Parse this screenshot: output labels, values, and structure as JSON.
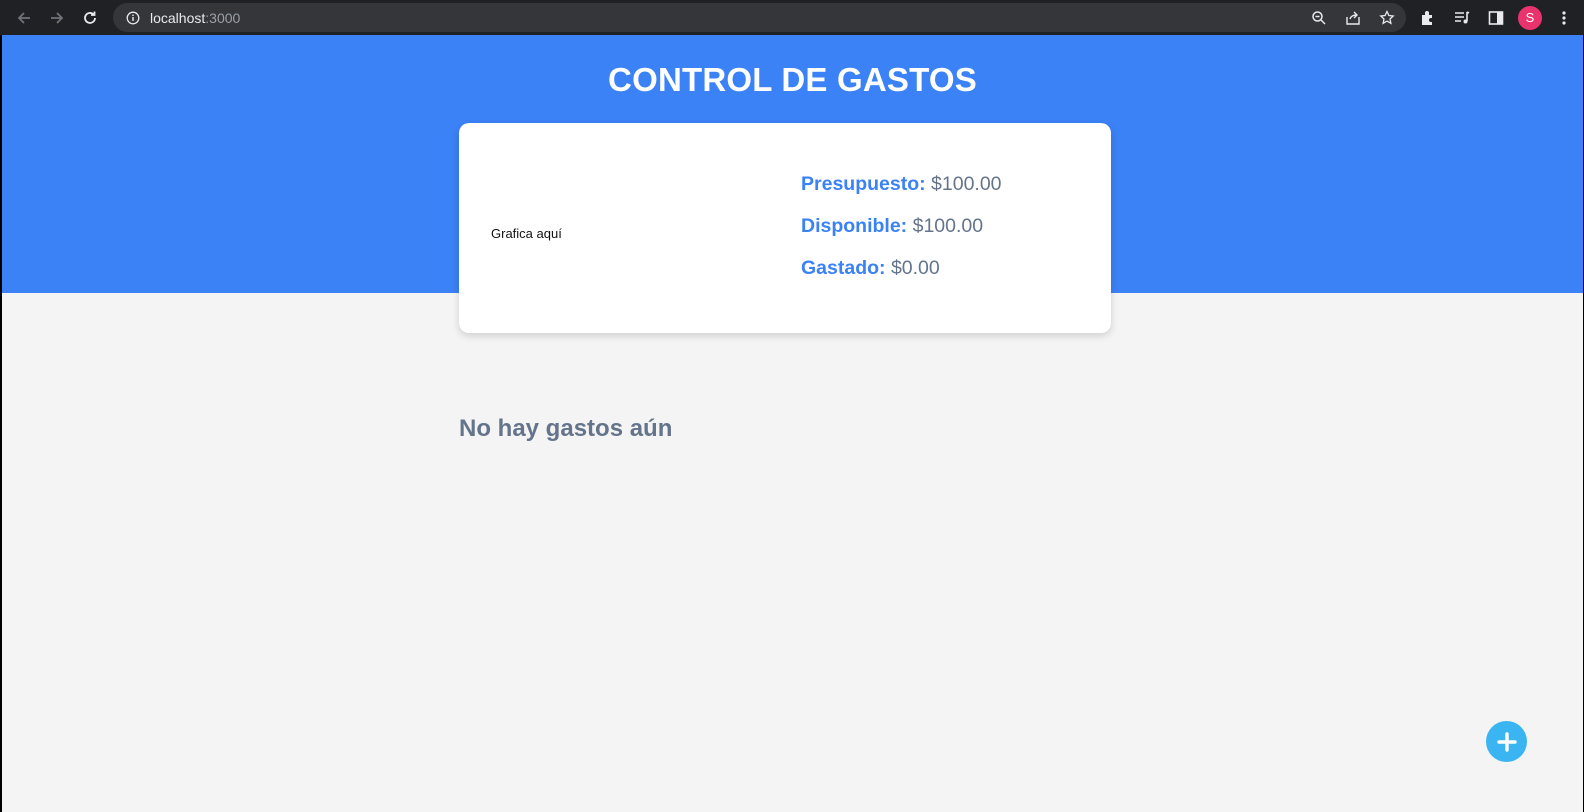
{
  "browser": {
    "url_host": "localhost",
    "url_port": ":3000",
    "avatar_initial": "S"
  },
  "app": {
    "title": "CONTROL DE GASTOS",
    "chart_placeholder": "Grafica aquí",
    "stats": [
      {
        "label": "Presupuesto:",
        "value": "$100.00"
      },
      {
        "label": "Disponible:",
        "value": "$100.00"
      },
      {
        "label": "Gastado:",
        "value": "$0.00"
      }
    ],
    "empty_message": "No hay gastos aún"
  },
  "colors": {
    "header_blue": "#3b82f6",
    "background": "#f4f4f4",
    "fab": "#3bb4f2",
    "text_muted": "#64748b"
  }
}
